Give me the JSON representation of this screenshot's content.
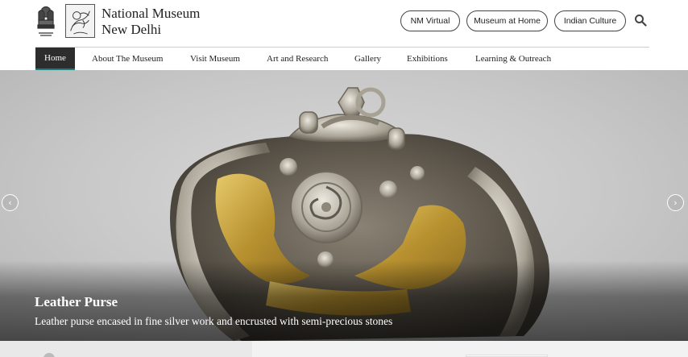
{
  "site": {
    "name_line1": "National Museum",
    "name_line2": "New Delhi"
  },
  "header_links": [
    "NM Virtual",
    "Museum at Home",
    "Indian Culture"
  ],
  "nav": {
    "items": [
      "Home",
      "About The Museum",
      "Visit Museum",
      "Art and Research",
      "Gallery",
      "Exhibitions",
      "Learning & Outreach"
    ],
    "active": "Home"
  },
  "hero": {
    "title": "Leather Purse",
    "description": "Leather purse encased in fine silver work and encrusted with semi-precious stones",
    "prev_icon": "chevron-left-icon",
    "next_icon": "chevron-right-icon"
  },
  "icons": {
    "search": "search-icon",
    "emblem": "state-emblem-icon",
    "seal": "museum-seal-logo"
  },
  "colors": {
    "nav_active_bg": "#2d2d2d",
    "nav_active_accent": "#1a7f7f",
    "gold": "#c9a640",
    "silver": "#b9b4a9"
  }
}
